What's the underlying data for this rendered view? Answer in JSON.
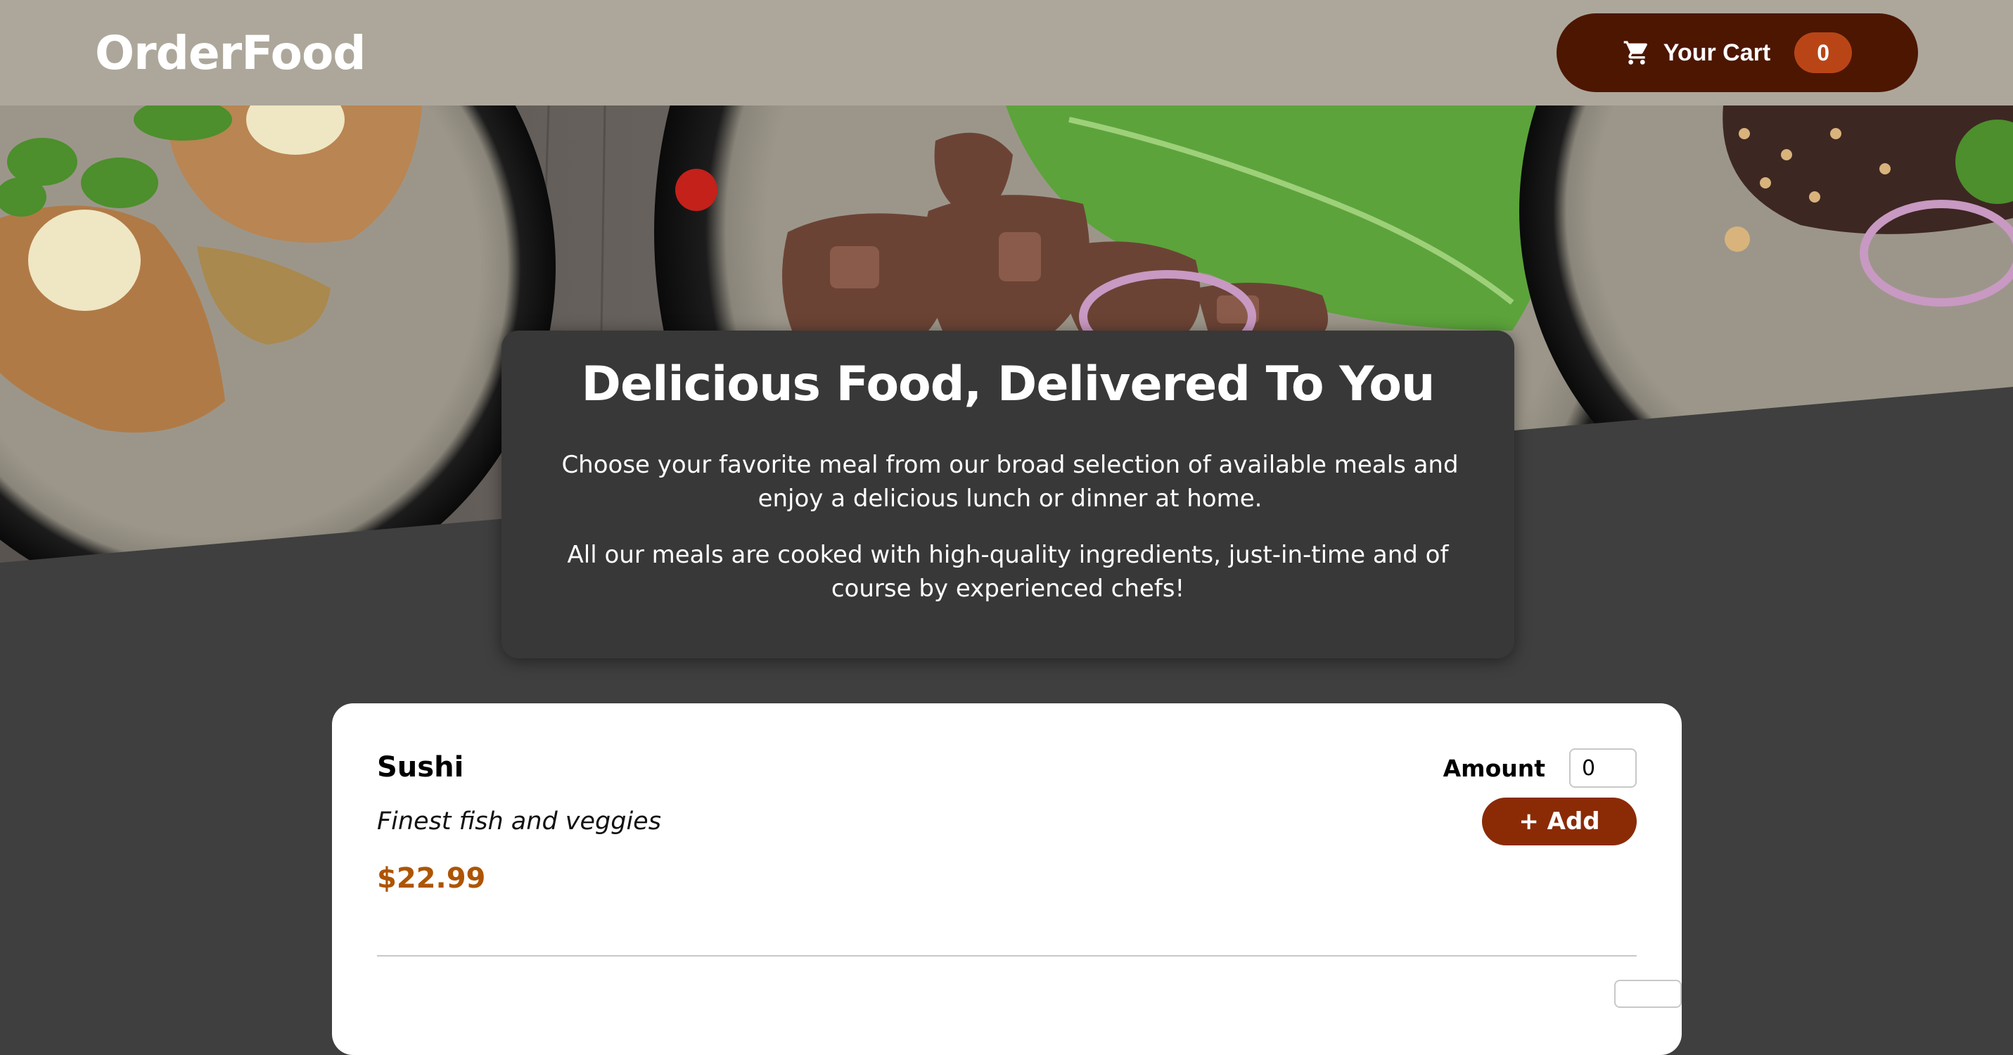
{
  "header": {
    "brand": "OrderFood",
    "cart_label": "Your Cart",
    "cart_count": "0",
    "cart_icon": "shopping-cart-icon"
  },
  "summary": {
    "title": "Delicious Food, Delivered To You",
    "paragraph_1": "Choose your favorite meal from our broad selection of available meals and enjoy a delicious lunch or dinner at home.",
    "paragraph_2": "All our meals are cooked with high-quality ingredients, just-in-time and of course by experienced chefs!"
  },
  "meals": [
    {
      "name": "Sushi",
      "description": "Finest fish and veggies",
      "price": "$22.99",
      "amount_label": "Amount",
      "amount_value": "0",
      "add_label": "+ Add"
    }
  ],
  "colors": {
    "header_bg": "#ada79b",
    "page_bg": "#3f3f3f",
    "cart_button": "#4d1601",
    "cart_badge": "#b94517",
    "add_button": "#8a2b06",
    "price": "#ad5502"
  }
}
